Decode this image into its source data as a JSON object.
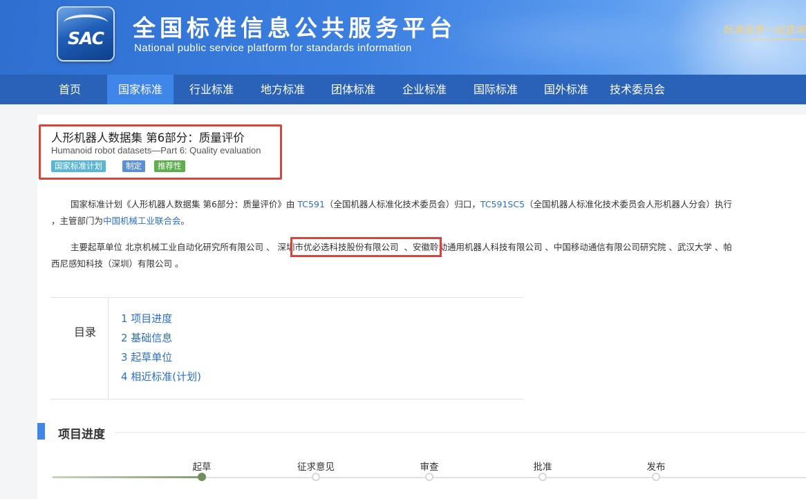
{
  "header": {
    "logo_text": "SAC",
    "title": "全国标准信息公共服务平台",
    "subtitle": "National public service platform  for standards information",
    "slogan": "标准信息一站查询"
  },
  "nav": {
    "items": [
      "首页",
      "国家标准",
      "行业标准",
      "地方标准",
      "团体标准",
      "企业标准",
      "国际标准",
      "国外标准",
      "技术委员会"
    ],
    "active_index": 1
  },
  "standard": {
    "title": "人形机器人数据集 第6部分：质量评价",
    "title_en": "Humanoid robot datasets—Part 6: Quality evaluation",
    "badges": [
      {
        "label": "国家标准计划",
        "color": "#5bb6d6"
      },
      {
        "label": "制定",
        "color": "#5b8fd6"
      },
      {
        "label": "推荐性",
        "color": "#5fae4e"
      }
    ]
  },
  "intro": {
    "p1_a": "国家标准计划《人形机器人数据集 第6部分：质量评价》由 ",
    "p1_tc": "TC591",
    "p1_b": "（全国机器人标准化技术委员会）归口，",
    "p1_sc": "TC591SC5",
    "p1_c": "（全国机器人标准化技术委员会人形机器人分会）执行",
    "p1_d": "，主管部门为",
    "p1_dept": "中国机械工业联合会",
    "p1_e": "。",
    "p2_a": "主要起草单位 北京机械工业自动化研究所有限公司 、",
    "p2_hl": "深圳市优必选科技股份有限公司",
    "p2_b": " 、安徽聆动通用机器人科技有限公司 、中国移动通信有限公司研究院 、武汉大学 、帕",
    "p2_c": "西尼感知科技（深圳）有限公司 。"
  },
  "toc": {
    "heading": "目录",
    "items": [
      "1  项目进度",
      "2  基础信息",
      "3  起草单位",
      "4  相近标准(计划)"
    ]
  },
  "progress": {
    "section_title": "项目进度",
    "steps": [
      "起草",
      "征求意见",
      "审查",
      "批准",
      "发布"
    ],
    "current_index": 0
  }
}
